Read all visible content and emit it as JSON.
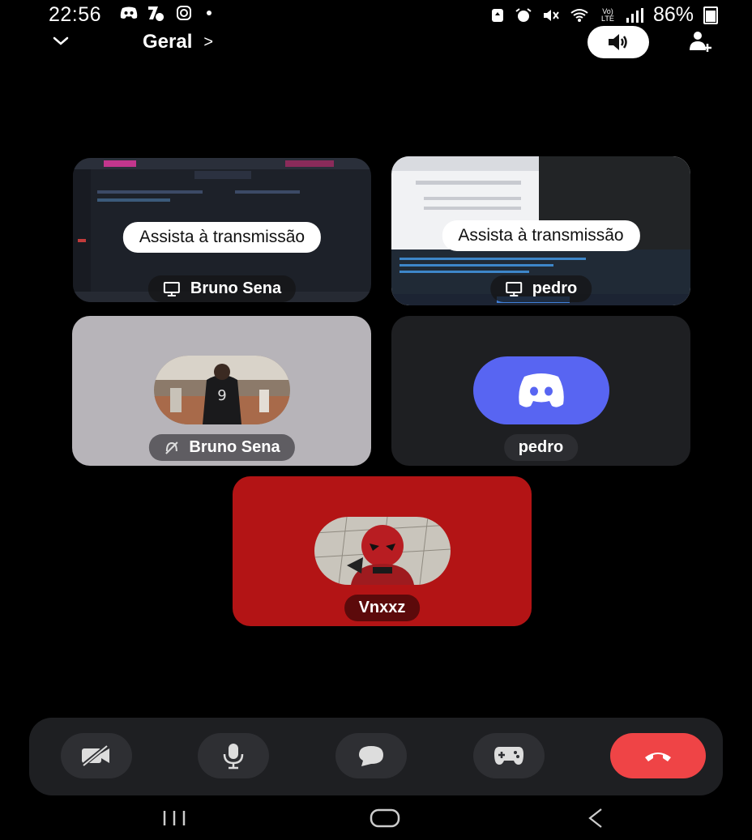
{
  "status_bar": {
    "time": "22:56",
    "battery": "86%",
    "signal_label": "Vo) LTE"
  },
  "header": {
    "channel_name": "Geral",
    "channel_arrow": ">"
  },
  "tiles": {
    "stream1": {
      "watch_label": "Assista à transmissão",
      "user": "Bruno Sena"
    },
    "stream2": {
      "watch_label": "Assista à transmissão",
      "user": "pedro"
    },
    "user1": {
      "name": "Bruno Sena",
      "bg": "#b7b4b9",
      "muted": true
    },
    "user2": {
      "name": "pedro",
      "bg": "#1e1f22"
    },
    "user3": {
      "name": "Vnxxz",
      "bg": "#b31415"
    }
  },
  "controls": {
    "icons": [
      "camera-off-icon",
      "microphone-icon",
      "chat-icon",
      "game-controller-icon",
      "hang-up-icon"
    ],
    "end_color": "#ef4446"
  },
  "colors": {
    "discord_blurple": "#5865f2"
  }
}
